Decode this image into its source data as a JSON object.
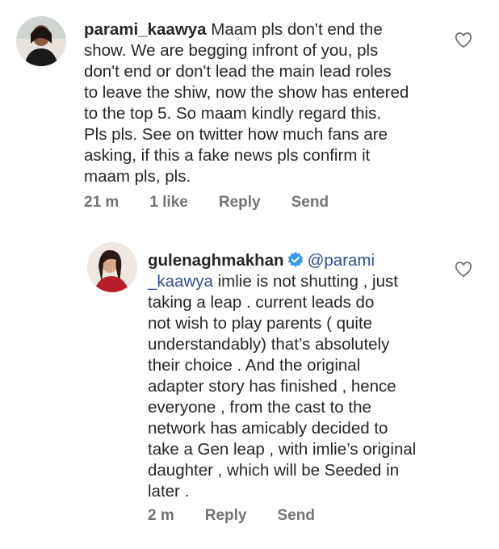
{
  "comments": [
    {
      "username": "parami_kaawya",
      "lines": [
        "Maam pls don't end the",
        "show. We are begging infront of you, pls",
        "don't end or don't lead the main lead roles",
        "to leave the shiw, now the show has entered",
        "to the top 5. So maam kindly regard this.",
        "Pls pls. See on twitter how much fans are",
        "asking, if this a fake news pls confirm it",
        "maam pls, pls."
      ],
      "time": "21 m",
      "likes": "1 like",
      "reply": "Reply",
      "send": "Send",
      "avatar_icon": "user-photo"
    },
    {
      "username": "gulenaghmakhan",
      "verified_icon": "verified-badge-icon",
      "mention_line1": "@parami",
      "mention_line2": "_kaawya",
      "line2_rest": " imlie is not shutting , just",
      "lines": [
        "taking a leap . current leads do",
        "not wish to play parents ( quite",
        "understandably) that’s absolutely",
        "their choice . And the original",
        "adapter story has finished , hence",
        "everyone , from the cast to the",
        "network has amicably decided to",
        "take a Gen leap , with imlie’s original",
        "daughter , which will be Seeded in",
        "later ."
      ],
      "time": "2 m",
      "reply": "Reply",
      "send": "Send",
      "avatar_icon": "user-photo"
    }
  ],
  "colors": {
    "text": "#262626",
    "meta": "#737373",
    "mention": "#2f4d9a",
    "verified": "#3897f0"
  }
}
